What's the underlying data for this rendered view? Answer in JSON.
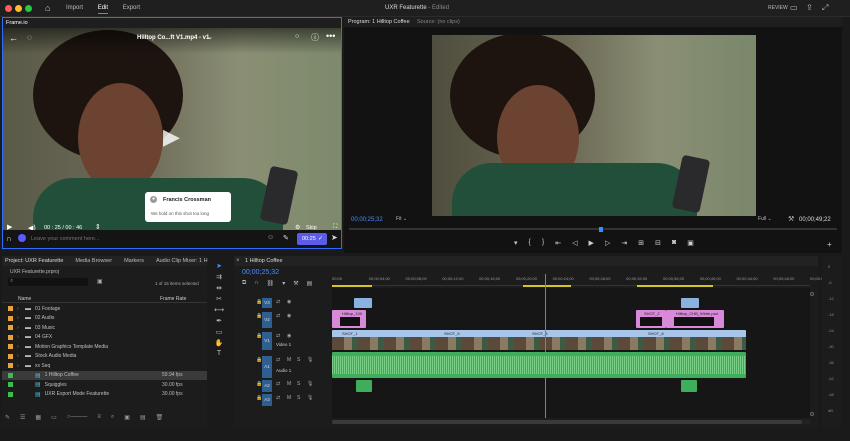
{
  "app": {
    "menu": [
      "Import",
      "Edit",
      "Export"
    ],
    "active_menu": "Edit",
    "title": "UXR Featurette",
    "subtitle": "- Edited",
    "review_label": "REVIEW"
  },
  "frameio": {
    "panel_tab": "Frame.io",
    "video_title": "Hilltop Co...ft V1.mp4 - v1",
    "timecode": "00 : 25 / 00 : 46",
    "skip_label": "Skip",
    "comment_author": "Francis Crossman",
    "comment_text": "We hold on this shot too long",
    "comment_placeholder": "Leave your comment here...",
    "comment_time": "00:25"
  },
  "program": {
    "tab_program": "Program: 1 Hilltop Coffee",
    "tab_source": "Source: (no clips)",
    "timecode_left": "00;00;25;32",
    "fit_label": "Fit",
    "quality_label": "Full",
    "timecode_right": "00;00;49;22"
  },
  "project": {
    "tabs": [
      "Project: UXR Featurette",
      "Media Browser",
      "Markers",
      "Audio Clip Mixer: 1 H"
    ],
    "project_file": "UXR Featurette.prproj",
    "selection_info": "1 of 15 items selected",
    "col_name": "Name",
    "col_rate": "Frame Rate",
    "items": [
      {
        "label": "01 Footage",
        "color": "#e8a33a",
        "rate": ""
      },
      {
        "label": "02 Audio",
        "color": "#e8a33a",
        "rate": ""
      },
      {
        "label": "03 Music",
        "color": "#e8a33a",
        "rate": ""
      },
      {
        "label": "04 GFX",
        "color": "#e8a33a",
        "rate": ""
      },
      {
        "label": "Motion Graphics Template Media",
        "color": "#e8a33a",
        "rate": ""
      },
      {
        "label": "Stock Audio Media",
        "color": "#e8a33a",
        "rate": ""
      },
      {
        "label": "xx Seq",
        "color": "#e8a33a",
        "rate": ""
      },
      {
        "label": "1 Hilltop Coffee",
        "color": "#3dbb4b",
        "rate": "59.94 fps"
      },
      {
        "label": "Squiggles",
        "color": "#3dbb4b",
        "rate": "30.00 fps"
      },
      {
        "label": "UXR Export Mode Featurette",
        "color": "#3dbb4b",
        "rate": "30.00 fps"
      }
    ]
  },
  "timeline": {
    "tab": "1 Hilltop Coffee",
    "timecode": "00;00;25;32",
    "ruler": [
      "00;00",
      "00;00;04;00",
      "00;00;08;00",
      "00;00;12;00",
      "00;00;16;00",
      "00;00;20;00",
      "00;00;24;00",
      "00;00;28;00",
      "00;00;32;00",
      "00;00;36;00",
      "00;00;40;00",
      "00;00;44;00",
      "00;00;48;00",
      "00;00;52;00"
    ],
    "tracks": [
      "V3",
      "V2",
      "V1",
      "A1",
      "A2",
      "A3"
    ],
    "v1_name": "Video 1",
    "a1_name": "Audio 1",
    "clip_labels": {
      "hilltop": "Hilltop_100",
      "shot1": "SHOT_1",
      "shot5": "SHOT_5",
      "shot6": "SHOT_6",
      "shot8": "SHOT_8",
      "hilltop2": "Hilltop_CHB_White.psd",
      "shot2": "SHOT_2"
    },
    "meter_labels": [
      "0",
      "-6",
      "-12",
      "-18",
      "-24",
      "-30",
      "-36",
      "-42",
      "-48",
      "dB"
    ]
  },
  "colors": {
    "accent": "#2d6cff",
    "playhead": "#3a8dff",
    "video_clip": "#a8c6ea",
    "pink_clip": "#d88ad8",
    "audio_clip": "#3fae5a"
  }
}
